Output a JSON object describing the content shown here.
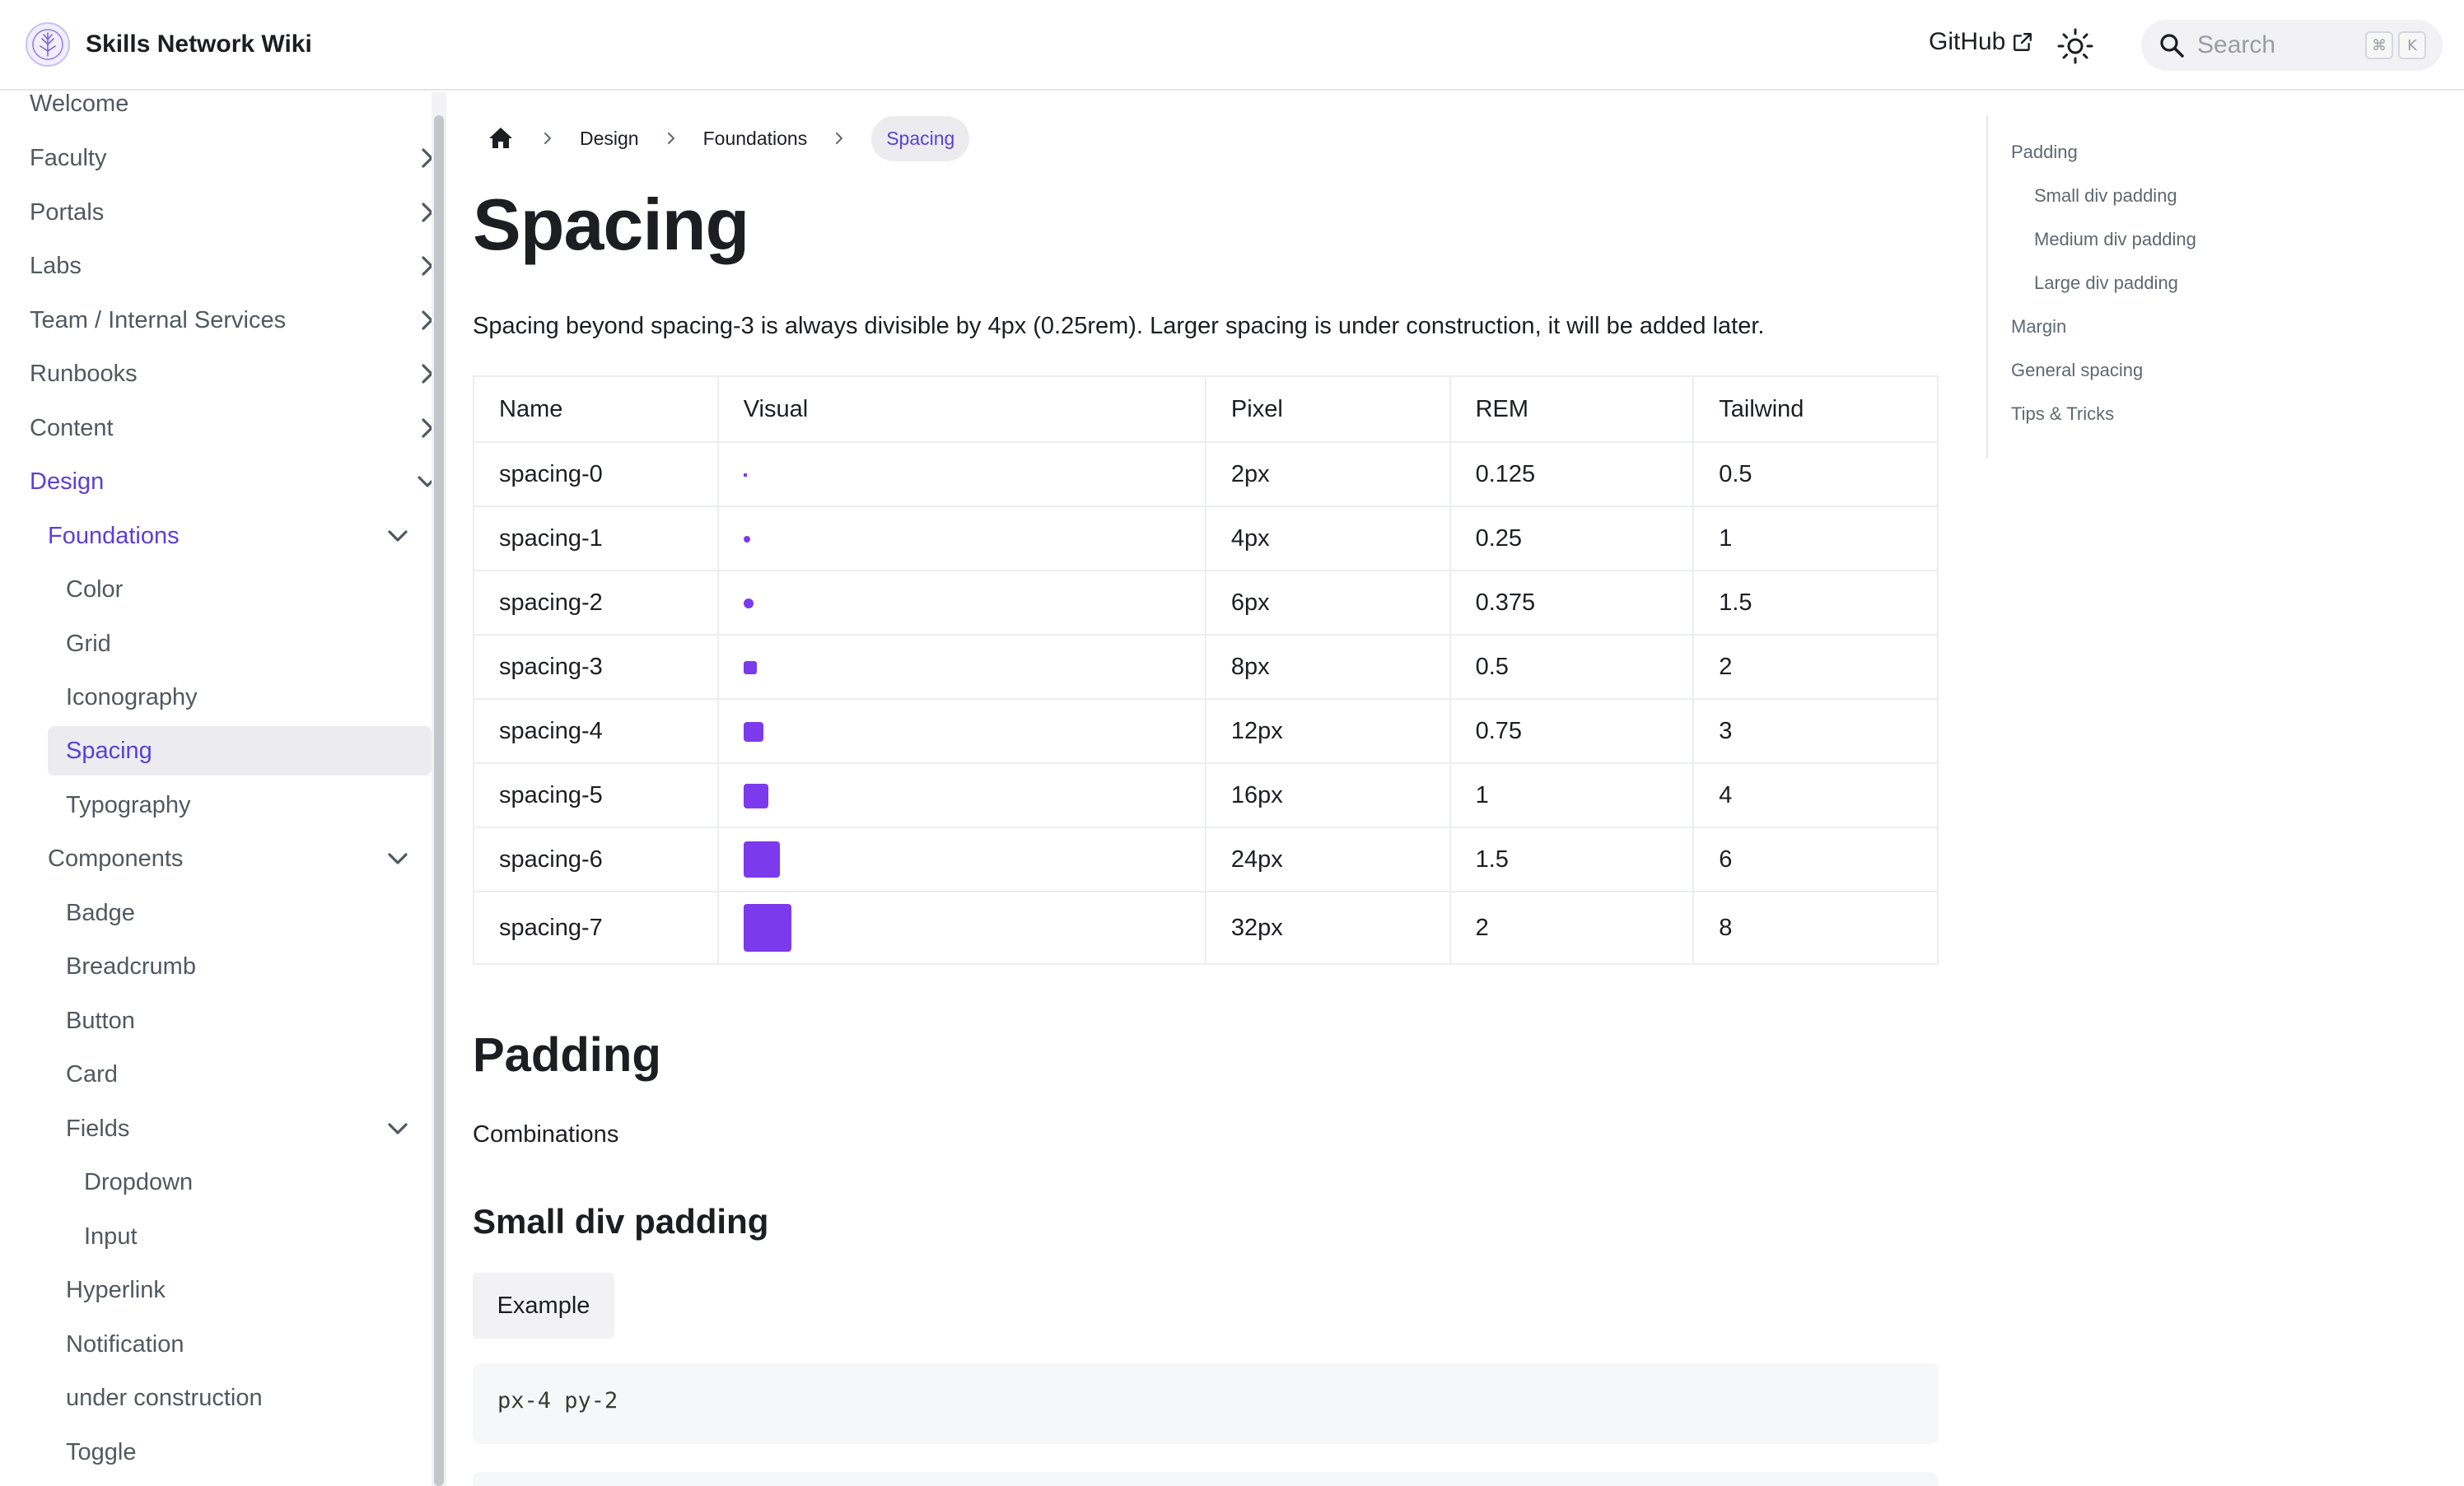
{
  "colors": {
    "accent": "#5b3fd6",
    "swatch": "#7c3aed"
  },
  "navbar": {
    "brand_title": "Skills Network Wiki",
    "github_label": "GitHub",
    "search_placeholder": "Search",
    "shortcut_keys": [
      "⌘",
      "K"
    ]
  },
  "sidebar": {
    "items": [
      {
        "label": "Welcome"
      },
      {
        "label": "Faculty"
      },
      {
        "label": "Portals"
      },
      {
        "label": "Labs"
      },
      {
        "label": "Team / Internal Services"
      },
      {
        "label": "Runbooks"
      },
      {
        "label": "Content"
      },
      {
        "label": "Design"
      },
      {
        "label": "Foundations"
      },
      {
        "label": "Color"
      },
      {
        "label": "Grid"
      },
      {
        "label": "Iconography"
      },
      {
        "label": "Spacing"
      },
      {
        "label": "Typography"
      },
      {
        "label": "Components"
      },
      {
        "label": "Badge"
      },
      {
        "label": "Breadcrumb"
      },
      {
        "label": "Button"
      },
      {
        "label": "Card"
      },
      {
        "label": "Fields"
      },
      {
        "label": "Dropdown"
      },
      {
        "label": "Input"
      },
      {
        "label": "Hyperlink"
      },
      {
        "label": "Notification"
      },
      {
        "label": "under construction"
      },
      {
        "label": "Toggle"
      }
    ]
  },
  "breadcrumbs": [
    "Design",
    "Foundations",
    "Spacing"
  ],
  "page": {
    "title": "Spacing",
    "intro": "Spacing beyond spacing-3 is always divisible by 4px (0.25rem). Larger spacing is under construction, it will be added later."
  },
  "table": {
    "headers": [
      "Name",
      "Visual",
      "Pixel",
      "REM",
      "Tailwind"
    ],
    "rows": [
      {
        "name": "spacing-0",
        "pixel": "2px",
        "rem": "0.125",
        "tailwind": "0.5"
      },
      {
        "name": "spacing-1",
        "pixel": "4px",
        "rem": "0.25",
        "tailwind": "1"
      },
      {
        "name": "spacing-2",
        "pixel": "6px",
        "rem": "0.375",
        "tailwind": "1.5"
      },
      {
        "name": "spacing-3",
        "pixel": "8px",
        "rem": "0.5",
        "tailwind": "2"
      },
      {
        "name": "spacing-4",
        "pixel": "12px",
        "rem": "0.75",
        "tailwind": "3"
      },
      {
        "name": "spacing-5",
        "pixel": "16px",
        "rem": "1",
        "tailwind": "4"
      },
      {
        "name": "spacing-6",
        "pixel": "24px",
        "rem": "1.5",
        "tailwind": "6"
      },
      {
        "name": "spacing-7",
        "pixel": "32px",
        "rem": "2",
        "tailwind": "8"
      }
    ]
  },
  "padding": {
    "heading": "Padding",
    "text": "Combinations",
    "small_heading": "Small div padding",
    "example_tab": "Example",
    "code": "px-4 py-2"
  },
  "toc": {
    "items": [
      {
        "label": "Padding"
      },
      {
        "label": "Small div padding"
      },
      {
        "label": "Medium div padding"
      },
      {
        "label": "Large div padding"
      },
      {
        "label": "Margin"
      },
      {
        "label": "General spacing"
      },
      {
        "label": "Tips & Tricks"
      }
    ]
  }
}
